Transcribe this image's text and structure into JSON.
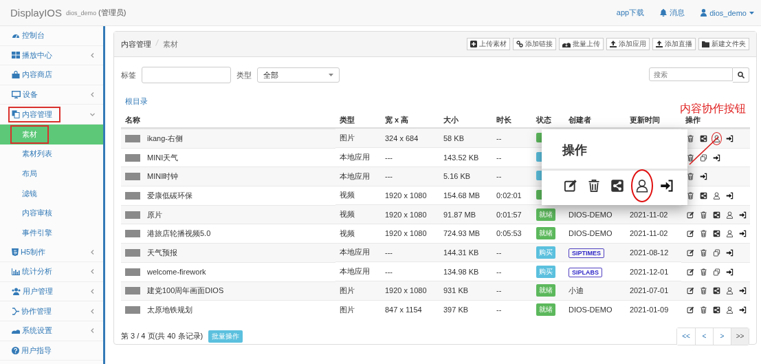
{
  "header": {
    "brand": "DisplayIOS",
    "account": "dios_demo",
    "role": "(管理员)",
    "links": [
      {
        "kind": "app",
        "label": "app下载"
      },
      {
        "kind": "bell",
        "label": "消息"
      },
      {
        "kind": "user",
        "label": "dios_demo"
      }
    ]
  },
  "sidebar": {
    "items": [
      {
        "label": "控制台",
        "expandable": false,
        "annotated": false
      },
      {
        "label": "播放中心",
        "expandable": true,
        "expanded": false,
        "annotated": false
      },
      {
        "label": "内容商店",
        "expandable": false,
        "annotated": false
      },
      {
        "label": "设备",
        "expandable": true,
        "expanded": false,
        "annotated": false
      },
      {
        "label": "内容管理",
        "expandable": true,
        "expanded": true,
        "annotated": true,
        "children": [
          {
            "label": "素材",
            "selected": true,
            "annotated": true
          },
          {
            "label": "素材列表",
            "selected": false,
            "annotated": false
          },
          {
            "label": "布局",
            "selected": false,
            "annotated": false
          },
          {
            "label": "滤镜",
            "selected": false,
            "annotated": false
          },
          {
            "label": "内容审核",
            "selected": false,
            "annotated": false
          },
          {
            "label": "事件引擎",
            "selected": false,
            "annotated": false
          }
        ]
      },
      {
        "label": "H5制作",
        "expandable": true,
        "expanded": false,
        "annotated": false
      },
      {
        "label": "统计分析",
        "expandable": true,
        "expanded": false,
        "annotated": false
      },
      {
        "label": "用户管理",
        "expandable": true,
        "expanded": false,
        "annotated": false
      },
      {
        "label": "协作管理",
        "expandable": true,
        "expanded": false,
        "annotated": false
      },
      {
        "label": "系统设置",
        "expandable": true,
        "expanded": false,
        "annotated": false
      },
      {
        "label": "用户指导",
        "expandable": false,
        "annotated": false
      }
    ]
  },
  "breadcrumb": [
    "内容管理",
    "素材"
  ],
  "toolbar": [
    {
      "kind": "plus",
      "label": "上传素材"
    },
    {
      "kind": "link",
      "label": "添加链接"
    },
    {
      "kind": "cloud",
      "label": "批量上传"
    },
    {
      "kind": "upload",
      "label": "添加应用"
    },
    {
      "kind": "upload",
      "label": "添加直播"
    },
    {
      "kind": "folder",
      "label": "新建文件夹"
    }
  ],
  "filters": {
    "tag_label": "标签",
    "type_label": "类型",
    "type_value": "全部",
    "search_placeholder": "搜索"
  },
  "folder_link": "根目录",
  "table": {
    "columns": [
      "名称",
      "类型",
      "宽 x 高",
      "大小",
      "时长",
      "状态",
      "创建者",
      "更新时间",
      "操作"
    ],
    "rows": [
      {
        "name": "ikang-右侧",
        "type": "图片",
        "size": "324 x 684",
        "file_size": "58 KB",
        "duration": "--",
        "status": {
          "kind": "ready"
        },
        "actions": [
          {
            "kind": "trash"
          },
          {
            "kind": "share"
          },
          {
            "kind": "user",
            "circled": true
          },
          {
            "kind": "enter"
          }
        ]
      },
      {
        "name": "MINI天气",
        "type": "本地应用",
        "size": "---",
        "file_size": "143.52 KB",
        "duration": "--",
        "status": {
          "kind": "bought"
        },
        "actions": [
          {
            "kind": "trash"
          },
          {
            "kind": "copy"
          },
          {
            "kind": "enter"
          }
        ]
      },
      {
        "name": "MINI时钟",
        "type": "本地应用",
        "size": "---",
        "file_size": "5.16 KB",
        "duration": "--",
        "status": {
          "kind": "bought"
        },
        "actions": [
          {
            "kind": "trash"
          },
          {
            "kind": "enter"
          }
        ]
      },
      {
        "name": "爱康低碳环保",
        "type": "视频",
        "size": "1920 x 1080",
        "file_size": "154.68 MB",
        "duration": "0:02:01",
        "status": {
          "kind": "ready"
        },
        "actions": [
          {
            "kind": "trash"
          },
          {
            "kind": "share"
          },
          {
            "kind": "user"
          },
          {
            "kind": "enter"
          }
        ]
      },
      {
        "name": "原片",
        "type": "视频",
        "size": "1920 x 1080",
        "file_size": "91.87 MB",
        "duration": "0:01:57",
        "status": {
          "kind": "ready",
          "label": "就绪"
        },
        "creator": {
          "kind": "text",
          "label": "DIOS-DEMO"
        },
        "updated": "2021-11-02",
        "actions": [
          {
            "kind": "edit"
          },
          {
            "kind": "trash"
          },
          {
            "kind": "share"
          },
          {
            "kind": "user"
          },
          {
            "kind": "enter"
          }
        ]
      },
      {
        "name": "港旅店轮播视频5.0",
        "type": "视频",
        "size": "1920 x 1080",
        "file_size": "724.93 MB",
        "duration": "0:05:53",
        "status": {
          "kind": "ready",
          "label": "就绪"
        },
        "creator": {
          "kind": "text",
          "label": "DIOS-DEMO"
        },
        "updated": "2021-11-02",
        "actions": [
          {
            "kind": "edit"
          },
          {
            "kind": "trash"
          },
          {
            "kind": "share"
          },
          {
            "kind": "user"
          },
          {
            "kind": "enter"
          }
        ]
      },
      {
        "name": "天气预报",
        "type": "本地应用",
        "size": "---",
        "file_size": "144.31 KB",
        "duration": "--",
        "status": {
          "kind": "bought",
          "label": "购买"
        },
        "creator": {
          "kind": "badge",
          "label": "SIPTIMES"
        },
        "updated": "2021-08-12",
        "actions": [
          {
            "kind": "edit"
          },
          {
            "kind": "trash"
          },
          {
            "kind": "copy"
          },
          {
            "kind": "enter"
          }
        ]
      },
      {
        "name": "welcome-firework",
        "type": "本地应用",
        "size": "---",
        "file_size": "134.98 KB",
        "duration": "--",
        "status": {
          "kind": "bought",
          "label": "购买"
        },
        "creator": {
          "kind": "badge",
          "label": "SIPLABS"
        },
        "updated": "2021-12-01",
        "actions": [
          {
            "kind": "edit"
          },
          {
            "kind": "trash"
          },
          {
            "kind": "copy"
          },
          {
            "kind": "enter"
          }
        ]
      },
      {
        "name": "建党100周年画面DIOS",
        "type": "图片",
        "size": "1920 x 1080",
        "file_size": "931 KB",
        "duration": "--",
        "status": {
          "kind": "ready",
          "label": "就绪"
        },
        "creator": {
          "kind": "text",
          "label": "小迪"
        },
        "updated": "2021-07-01",
        "actions": [
          {
            "kind": "edit"
          },
          {
            "kind": "trash"
          },
          {
            "kind": "share"
          },
          {
            "kind": "user"
          },
          {
            "kind": "enter"
          }
        ]
      },
      {
        "name": "太原地铁规划",
        "type": "图片",
        "size": "847 x 1154",
        "file_size": "397 KB",
        "duration": "--",
        "status": {
          "kind": "ready",
          "label": "就绪"
        },
        "creator": {
          "kind": "text",
          "label": "DIOS-DEMO"
        },
        "updated": "2021-01-09",
        "actions": [
          {
            "kind": "edit"
          },
          {
            "kind": "trash"
          },
          {
            "kind": "share"
          },
          {
            "kind": "user"
          },
          {
            "kind": "enter"
          }
        ]
      }
    ]
  },
  "footer": {
    "summary": "第 3 / 4 页(共 40 条记录)",
    "batch_button": "批量操作",
    "pages": [
      "<<",
      "<",
      ">",
      ">>"
    ]
  },
  "popup": {
    "title": "操作",
    "actions": [
      {
        "kind": "edit"
      },
      {
        "kind": "trash"
      },
      {
        "kind": "share"
      },
      {
        "kind": "user",
        "circled": true
      },
      {
        "kind": "enter"
      }
    ]
  },
  "annotation": {
    "text": "内容协作按钮"
  }
}
